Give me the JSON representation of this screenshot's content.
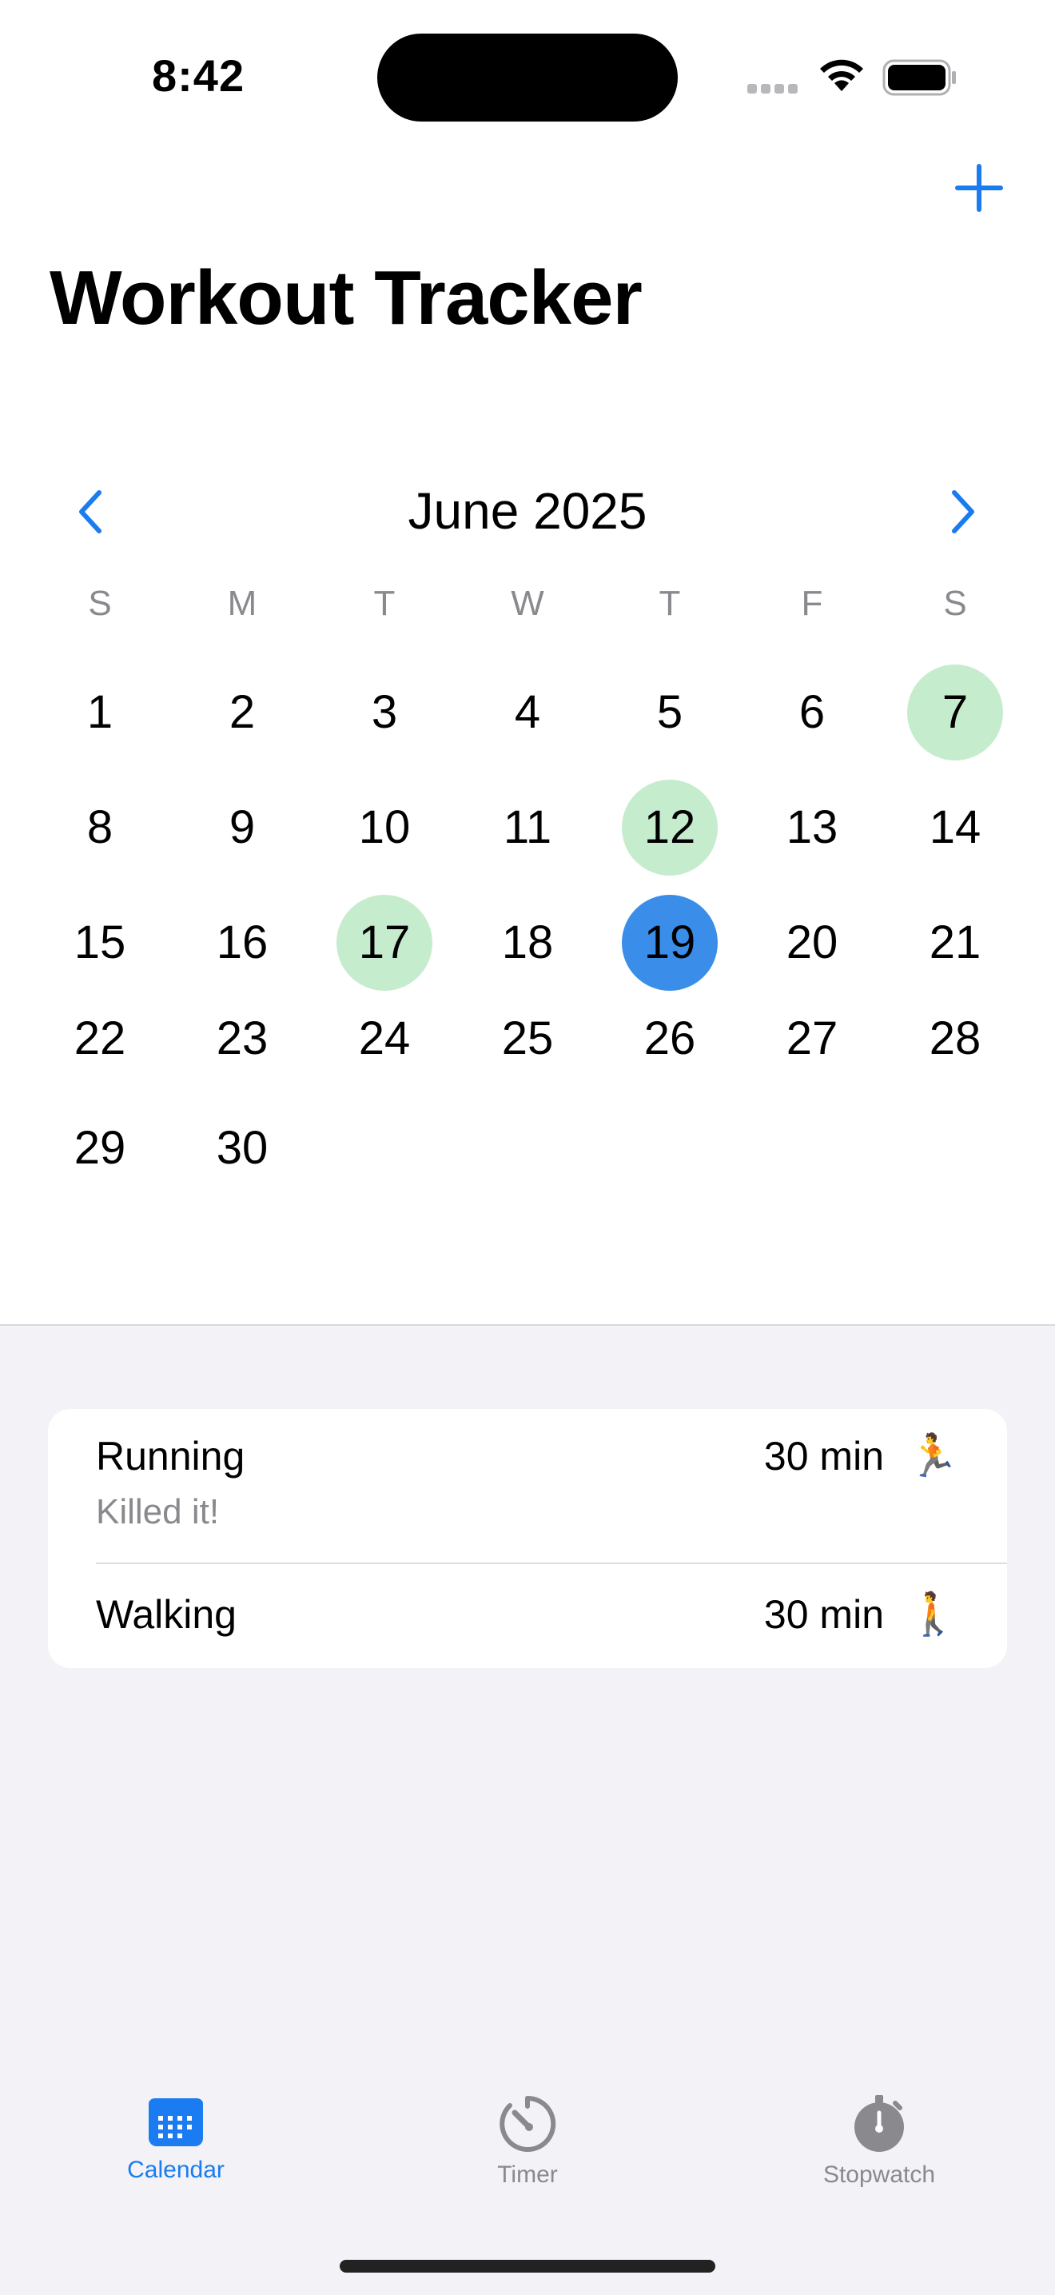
{
  "status": {
    "time": "8:42"
  },
  "header": {
    "title": "Workout Tracker",
    "add_icon": "plus-icon"
  },
  "calendar": {
    "month_label": "June 2025",
    "weekdays": [
      "S",
      "M",
      "T",
      "W",
      "T",
      "F",
      "S"
    ],
    "days": [
      "1",
      "2",
      "3",
      "4",
      "5",
      "6",
      "7",
      "8",
      "9",
      "10",
      "11",
      "12",
      "13",
      "14",
      "15",
      "16",
      "17",
      "18",
      "19",
      "20",
      "21",
      "22",
      "23",
      "24",
      "25",
      "26",
      "27",
      "28",
      "29",
      "30"
    ],
    "logged_days": [
      7,
      12,
      17
    ],
    "selected_day": 19,
    "colors": {
      "logged": "#c6ecce",
      "selected": "#3a8ee9",
      "accent": "#1a7cf0"
    }
  },
  "workouts": [
    {
      "name": "Running",
      "note": "Killed it!",
      "duration": "30 min",
      "emoji": "🏃"
    },
    {
      "name": "Walking",
      "note": "",
      "duration": "30 min",
      "emoji": "🚶"
    }
  ],
  "tabs": [
    {
      "label": "Calendar",
      "icon": "calendar-icon",
      "active": true
    },
    {
      "label": "Timer",
      "icon": "timer-icon",
      "active": false
    },
    {
      "label": "Stopwatch",
      "icon": "stopwatch-icon",
      "active": false
    }
  ]
}
